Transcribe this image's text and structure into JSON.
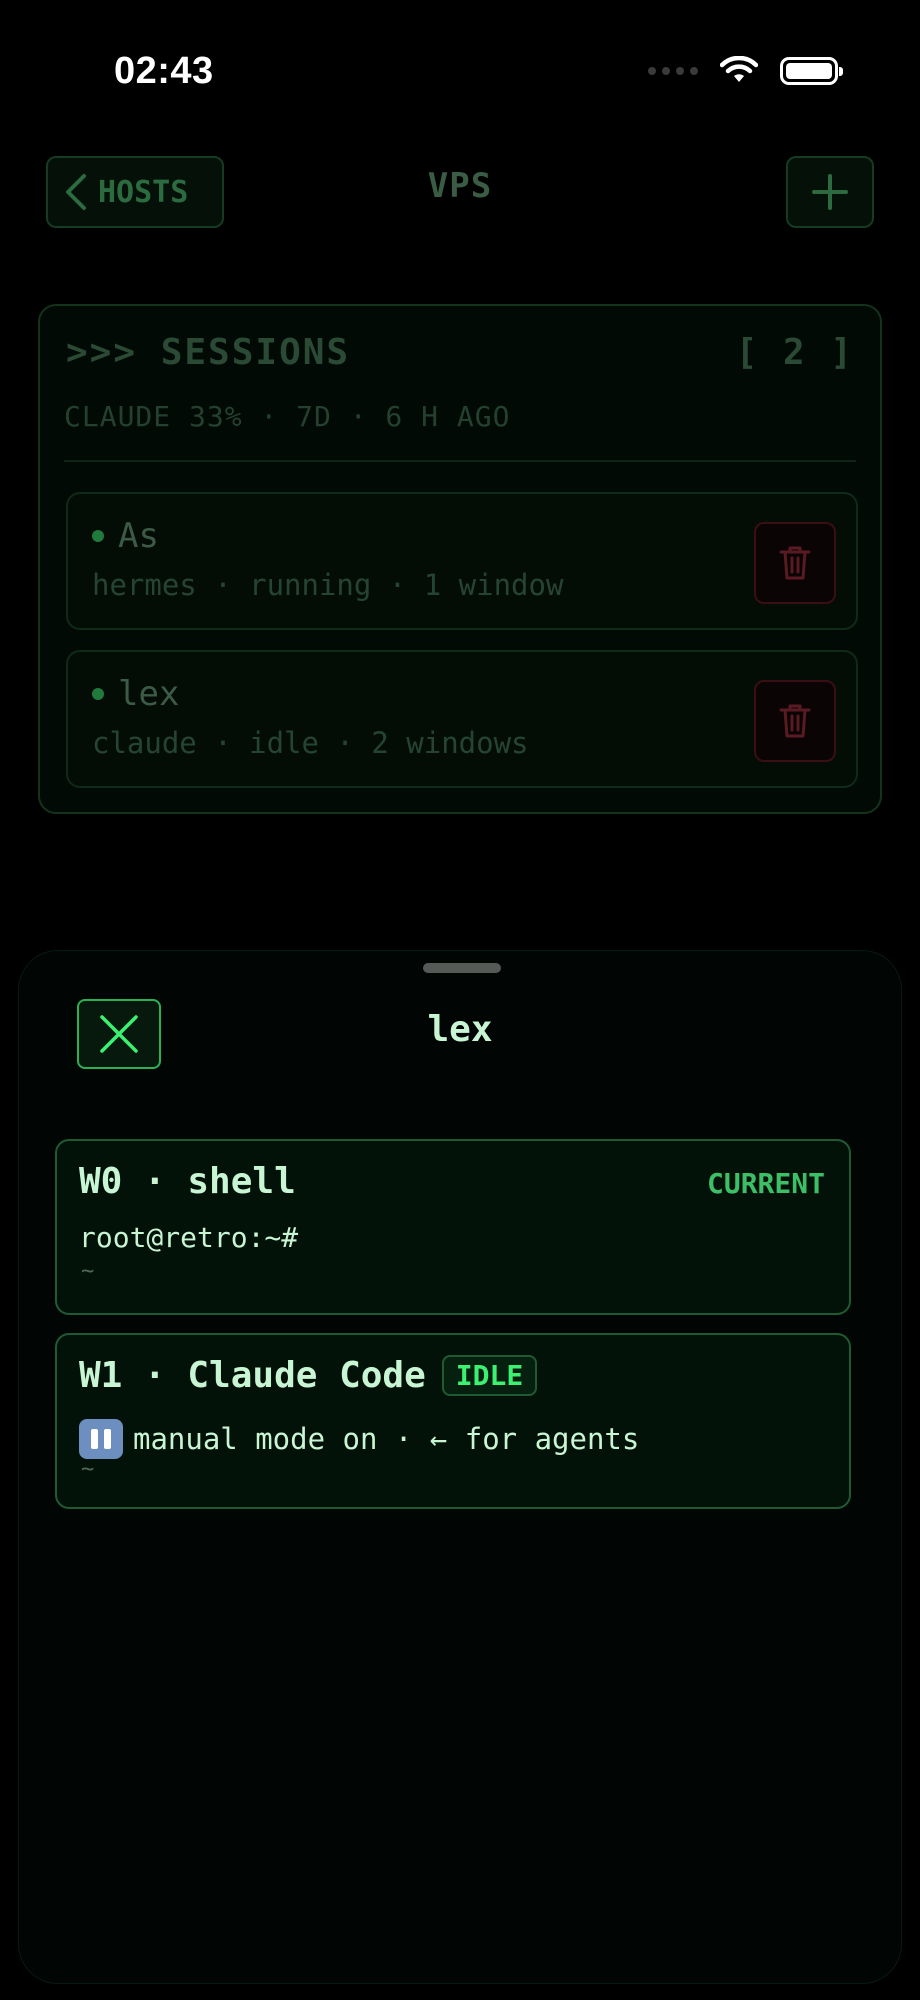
{
  "status_bar": {
    "time": "02:43"
  },
  "nav": {
    "back_label": "HOSTS",
    "title": "VPS"
  },
  "sessions": {
    "header": ">>> SESSIONS",
    "count": "[ 2 ]",
    "meta": "CLAUDE 33% · 7D · 6 H AGO",
    "items": [
      {
        "name": "As",
        "info": "hermes · running · 1 window"
      },
      {
        "name": "lex",
        "info": "claude · idle · 2 windows"
      }
    ]
  },
  "sheet": {
    "title": "lex",
    "windows": [
      {
        "title": "W0 · shell",
        "current": "CURRENT",
        "line1": "root@retro:~#",
        "tilde": "~"
      },
      {
        "title": "W1 · Claude Code",
        "badge": "IDLE",
        "line1": "manual mode on · ← for agents",
        "tilde": "~"
      }
    ]
  },
  "colors": {
    "accent": "#3cf072",
    "danger": "#8a1f2a",
    "background": "#000000"
  },
  "icons": [
    "wifi-icon",
    "battery-icon",
    "chevron-left-icon",
    "plus-icon",
    "trash-icon",
    "close-icon",
    "pause-icon"
  ]
}
